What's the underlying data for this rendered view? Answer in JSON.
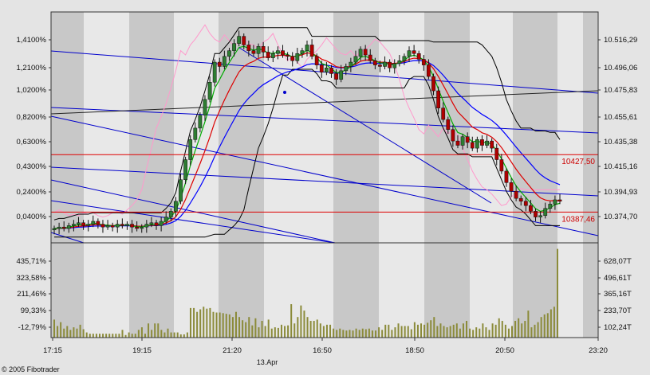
{
  "app": {
    "copyright": "© 2005 Fibotrader",
    "date_label": "13.Apr"
  },
  "colors": {
    "background": "#e4e4e4",
    "plot_bg": "#e8e8e8",
    "session_band": "#c8c8c8",
    "up_candle": "#2e7d32",
    "down_candle": "#b00000",
    "trendline": "#0000cc",
    "level": "#dd0000",
    "ma_fast": "#00aa00",
    "ma_mid": "#dd0000",
    "ma_slow": "#0000ff",
    "envelope": "#000000",
    "pink_line": "#ff99cc",
    "volume": "#8b8b3a"
  },
  "chart_data": [
    {
      "type": "candlestick",
      "title": "",
      "x_tick_labels": [
        "17:15",
        "19:15",
        "21:20",
        "16:50",
        "18:50",
        "20:50",
        "23:20"
      ],
      "left_axis_labels": [
        "1,4100%",
        "1,2100%",
        "1,0200%",
        "0,8200%",
        "0,6300%",
        "0,4300%",
        "0,2400%",
        "0,0400%"
      ],
      "right_axis_labels": [
        "10.516,29",
        "10.496,06",
        "10.475,83",
        "10.455,61",
        "10.435,38",
        "10.415,16",
        "10.394,93",
        "10.374,70"
      ],
      "ylim_right": [
        10366,
        10527
      ],
      "ylim_left_percent": [
        -0.08,
        1.51
      ],
      "levels": [
        {
          "label": "10427,50",
          "value": 10427.5
        },
        {
          "label": "10387,46",
          "value": 10387.46
        }
      ],
      "candles_close": [
        10376,
        10377,
        10376,
        10378,
        10379,
        10380,
        10378,
        10379,
        10381,
        10379,
        10377,
        10378,
        10377,
        10379,
        10378,
        10379,
        10377,
        10376,
        10377,
        10379,
        10380,
        10378,
        10381,
        10384,
        10388,
        10395,
        10410,
        10424,
        10438,
        10446,
        10455,
        10466,
        10478,
        10492,
        10489,
        10496,
        10500,
        10505,
        10510,
        10504,
        10500,
        10498,
        10503,
        10499,
        10495,
        10498,
        10500,
        10497,
        10496,
        10493,
        10498,
        10500,
        10504,
        10496,
        10490,
        10485,
        10488,
        10484,
        10480,
        10486,
        10489,
        10492,
        10496,
        10501,
        10497,
        10493,
        10490,
        10489,
        10492,
        10488,
        10491,
        10493,
        10496,
        10500,
        10498,
        10494,
        10490,
        10482,
        10472,
        10460,
        10452,
        10445,
        10437,
        10434,
        10440,
        10436,
        10432,
        10438,
        10434,
        10437,
        10432,
        10424,
        10416,
        10408,
        10402,
        10397,
        10395,
        10392,
        10388,
        10384,
        10385,
        10390,
        10393,
        10396,
        10395
      ]
    },
    {
      "type": "bar",
      "title": "",
      "left_axis_labels": [
        "435,71%",
        "323,58%",
        "211,46%",
        "99,33%",
        "-12,79%"
      ],
      "right_axis_labels": [
        "628,07T",
        "496,61T",
        "365,16T",
        "233,70T",
        "102,24T"
      ],
      "ylim": [
        0,
        700
      ],
      "values": [
        140,
        90,
        120,
        70,
        90,
        60,
        80,
        70,
        100,
        65,
        40,
        30,
        30,
        30,
        30,
        30,
        30,
        30,
        30,
        30,
        30,
        60,
        20,
        40,
        30,
        30,
        60,
        80,
        30,
        110,
        60,
        110,
        110,
        60,
        40,
        70,
        40,
        40,
        40,
        25,
        25,
        40,
        230,
        230,
        200,
        220,
        240,
        225,
        230,
        200,
        195,
        195,
        190,
        185,
        180,
        160,
        200,
        160,
        135,
        120,
        160,
        95,
        150,
        80,
        130,
        90,
        140,
        70,
        80,
        75,
        100,
        90,
        95,
        260,
        110,
        160,
        250,
        210,
        160,
        130,
        130,
        140,
        110,
        90,
        100,
        100,
        70,
        60,
        70,
        60,
        55,
        60,
        55,
        70,
        60,
        70,
        65,
        70,
        55,
        55,
        80,
        60,
        100,
        100,
        60,
        80,
        110,
        90,
        90,
        90,
        65,
        120,
        100,
        110,
        100,
        115,
        135,
        160,
        90,
        110,
        90,
        80,
        90,
        100,
        110,
        70,
        110,
        130,
        70,
        60,
        80,
        70,
        110,
        80,
        60,
        110,
        100,
        150,
        130,
        100,
        70,
        90,
        130,
        150,
        110,
        130,
        210,
        80,
        100,
        120,
        160,
        180,
        190,
        220,
        240,
        690
      ]
    }
  ]
}
